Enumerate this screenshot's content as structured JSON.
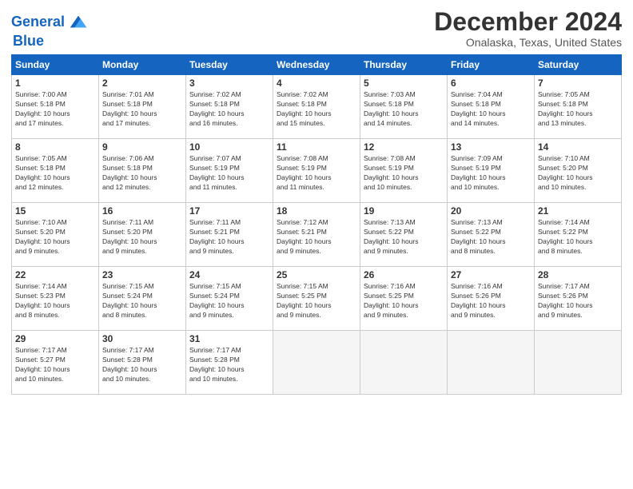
{
  "logo": {
    "line1": "General",
    "line2": "Blue"
  },
  "title": "December 2024",
  "location": "Onalaska, Texas, United States",
  "days_of_week": [
    "Sunday",
    "Monday",
    "Tuesday",
    "Wednesday",
    "Thursday",
    "Friday",
    "Saturday"
  ],
  "weeks": [
    [
      {
        "day": "1",
        "sunrise": "7:00 AM",
        "sunset": "5:18 PM",
        "daylight": "10 hours and 17 minutes."
      },
      {
        "day": "2",
        "sunrise": "7:01 AM",
        "sunset": "5:18 PM",
        "daylight": "10 hours and 17 minutes."
      },
      {
        "day": "3",
        "sunrise": "7:02 AM",
        "sunset": "5:18 PM",
        "daylight": "10 hours and 16 minutes."
      },
      {
        "day": "4",
        "sunrise": "7:02 AM",
        "sunset": "5:18 PM",
        "daylight": "10 hours and 15 minutes."
      },
      {
        "day": "5",
        "sunrise": "7:03 AM",
        "sunset": "5:18 PM",
        "daylight": "10 hours and 14 minutes."
      },
      {
        "day": "6",
        "sunrise": "7:04 AM",
        "sunset": "5:18 PM",
        "daylight": "10 hours and 14 minutes."
      },
      {
        "day": "7",
        "sunrise": "7:05 AM",
        "sunset": "5:18 PM",
        "daylight": "10 hours and 13 minutes."
      }
    ],
    [
      {
        "day": "8",
        "sunrise": "7:05 AM",
        "sunset": "5:18 PM",
        "daylight": "10 hours and 12 minutes."
      },
      {
        "day": "9",
        "sunrise": "7:06 AM",
        "sunset": "5:18 PM",
        "daylight": "10 hours and 12 minutes."
      },
      {
        "day": "10",
        "sunrise": "7:07 AM",
        "sunset": "5:19 PM",
        "daylight": "10 hours and 11 minutes."
      },
      {
        "day": "11",
        "sunrise": "7:08 AM",
        "sunset": "5:19 PM",
        "daylight": "10 hours and 11 minutes."
      },
      {
        "day": "12",
        "sunrise": "7:08 AM",
        "sunset": "5:19 PM",
        "daylight": "10 hours and 10 minutes."
      },
      {
        "day": "13",
        "sunrise": "7:09 AM",
        "sunset": "5:19 PM",
        "daylight": "10 hours and 10 minutes."
      },
      {
        "day": "14",
        "sunrise": "7:10 AM",
        "sunset": "5:20 PM",
        "daylight": "10 hours and 10 minutes."
      }
    ],
    [
      {
        "day": "15",
        "sunrise": "7:10 AM",
        "sunset": "5:20 PM",
        "daylight": "10 hours and 9 minutes."
      },
      {
        "day": "16",
        "sunrise": "7:11 AM",
        "sunset": "5:20 PM",
        "daylight": "10 hours and 9 minutes."
      },
      {
        "day": "17",
        "sunrise": "7:11 AM",
        "sunset": "5:21 PM",
        "daylight": "10 hours and 9 minutes."
      },
      {
        "day": "18",
        "sunrise": "7:12 AM",
        "sunset": "5:21 PM",
        "daylight": "10 hours and 9 minutes."
      },
      {
        "day": "19",
        "sunrise": "7:13 AM",
        "sunset": "5:22 PM",
        "daylight": "10 hours and 9 minutes."
      },
      {
        "day": "20",
        "sunrise": "7:13 AM",
        "sunset": "5:22 PM",
        "daylight": "10 hours and 8 minutes."
      },
      {
        "day": "21",
        "sunrise": "7:14 AM",
        "sunset": "5:22 PM",
        "daylight": "10 hours and 8 minutes."
      }
    ],
    [
      {
        "day": "22",
        "sunrise": "7:14 AM",
        "sunset": "5:23 PM",
        "daylight": "10 hours and 8 minutes."
      },
      {
        "day": "23",
        "sunrise": "7:15 AM",
        "sunset": "5:24 PM",
        "daylight": "10 hours and 8 minutes."
      },
      {
        "day": "24",
        "sunrise": "7:15 AM",
        "sunset": "5:24 PM",
        "daylight": "10 hours and 9 minutes."
      },
      {
        "day": "25",
        "sunrise": "7:15 AM",
        "sunset": "5:25 PM",
        "daylight": "10 hours and 9 minutes."
      },
      {
        "day": "26",
        "sunrise": "7:16 AM",
        "sunset": "5:25 PM",
        "daylight": "10 hours and 9 minutes."
      },
      {
        "day": "27",
        "sunrise": "7:16 AM",
        "sunset": "5:26 PM",
        "daylight": "10 hours and 9 minutes."
      },
      {
        "day": "28",
        "sunrise": "7:17 AM",
        "sunset": "5:26 PM",
        "daylight": "10 hours and 9 minutes."
      }
    ],
    [
      {
        "day": "29",
        "sunrise": "7:17 AM",
        "sunset": "5:27 PM",
        "daylight": "10 hours and 10 minutes."
      },
      {
        "day": "30",
        "sunrise": "7:17 AM",
        "sunset": "5:28 PM",
        "daylight": "10 hours and 10 minutes."
      },
      {
        "day": "31",
        "sunrise": "7:17 AM",
        "sunset": "5:28 PM",
        "daylight": "10 hours and 10 minutes."
      },
      null,
      null,
      null,
      null
    ]
  ],
  "labels": {
    "sunrise": "Sunrise:",
    "sunset": "Sunset:",
    "daylight": "Daylight:"
  }
}
